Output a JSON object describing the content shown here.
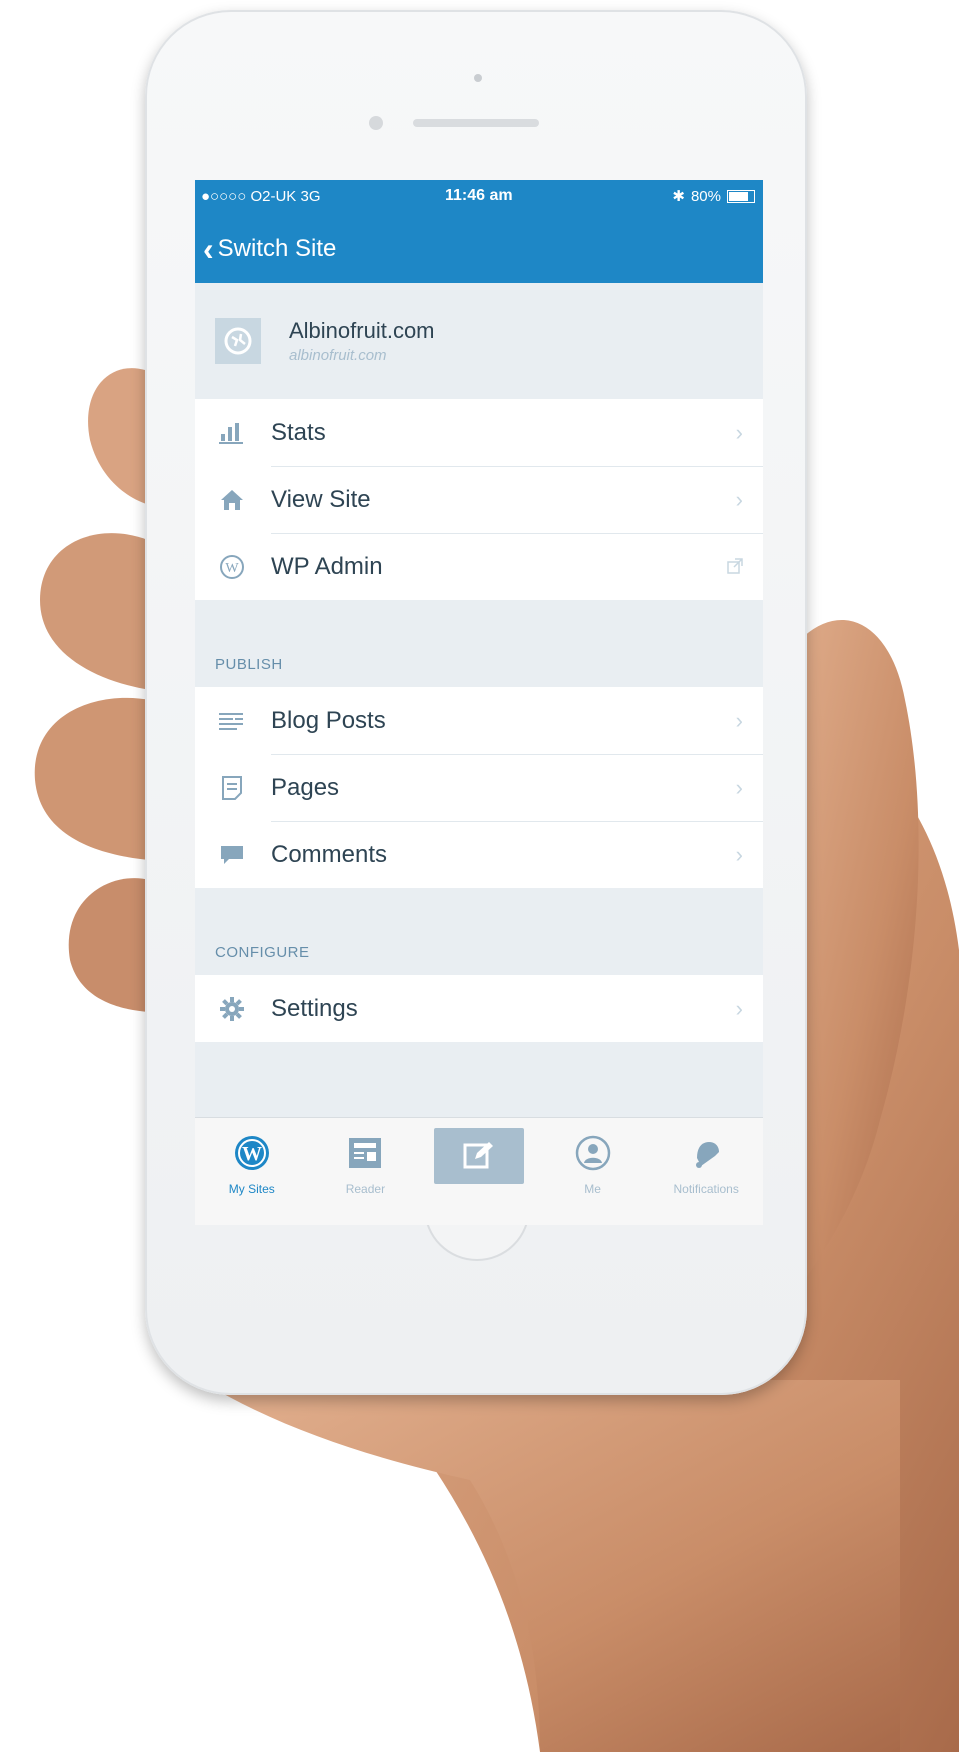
{
  "status_bar": {
    "carrier": "●○○○○ O2-UK  3G",
    "time": "11:46 am",
    "battery": "80%",
    "battery_level": 0.8
  },
  "nav": {
    "back_label": "Switch Site"
  },
  "site": {
    "name": "Albinofruit.com",
    "url": "albinofruit.com"
  },
  "menu": {
    "top_items": [
      {
        "label": "Stats",
        "icon": "stats-icon"
      },
      {
        "label": "View Site",
        "icon": "home-icon"
      },
      {
        "label": "WP Admin",
        "icon": "wordpress-icon"
      }
    ],
    "publish_header": "PUBLISH",
    "publish_items": [
      {
        "label": "Blog Posts",
        "icon": "posts-icon"
      },
      {
        "label": "Pages",
        "icon": "pages-icon"
      },
      {
        "label": "Comments",
        "icon": "comments-icon"
      }
    ],
    "configure_header": "CONFIGURE",
    "configure_items": [
      {
        "label": "Settings",
        "icon": "gear-icon"
      }
    ]
  },
  "tab_bar": {
    "tabs": [
      {
        "label": "My Sites",
        "icon": "wordpress-icon",
        "active": true
      },
      {
        "label": "Reader",
        "icon": "reader-icon",
        "active": false
      },
      {
        "label": "",
        "icon": "compose-icon",
        "active": false
      },
      {
        "label": "Me",
        "icon": "person-icon",
        "active": false
      },
      {
        "label": "Notifications",
        "icon": "bell-icon",
        "active": false
      }
    ]
  },
  "colors": {
    "accent": "#1e87c6",
    "text_primary": "#2e4453",
    "icon_gray": "#87a6bc",
    "background": "#e9eef2"
  }
}
